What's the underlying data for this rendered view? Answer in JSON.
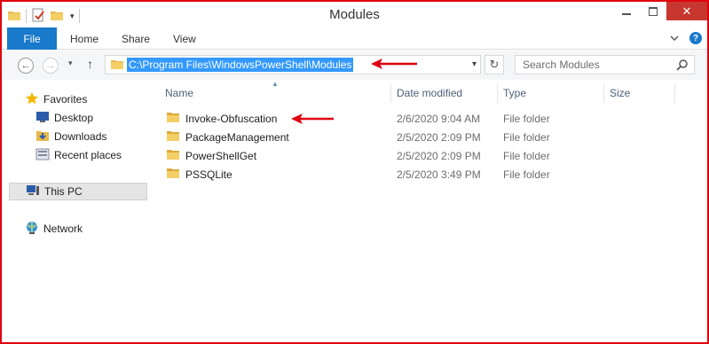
{
  "window": {
    "title": "Modules"
  },
  "ribbon": {
    "tabs": [
      {
        "label": "File"
      },
      {
        "label": "Home"
      },
      {
        "label": "Share"
      },
      {
        "label": "View"
      }
    ]
  },
  "address": {
    "path": "C:\\Program Files\\WindowsPowerShell\\Modules"
  },
  "search": {
    "placeholder": "Search Modules"
  },
  "sidebar": {
    "favorites": "Favorites",
    "items": [
      {
        "label": "Desktop"
      },
      {
        "label": "Downloads"
      },
      {
        "label": "Recent places"
      }
    ],
    "this_pc": "This PC",
    "network": "Network"
  },
  "columns": {
    "name": "Name",
    "date": "Date modified",
    "type": "Type",
    "size": "Size"
  },
  "files": [
    {
      "name": "Invoke-Obfuscation",
      "date": "2/6/2020 9:04 AM",
      "type": "File folder"
    },
    {
      "name": "PackageManagement",
      "date": "2/5/2020 2:09 PM",
      "type": "File folder"
    },
    {
      "name": "PowerShellGet",
      "date": "2/5/2020 2:09 PM",
      "type": "File folder"
    },
    {
      "name": "PSSQLite",
      "date": "2/5/2020 3:49 PM",
      "type": "File folder"
    }
  ],
  "colors": {
    "accent": "#1979ca",
    "selection": "#3399ff",
    "annotation": "#e0000f",
    "close": "#c7372f"
  }
}
